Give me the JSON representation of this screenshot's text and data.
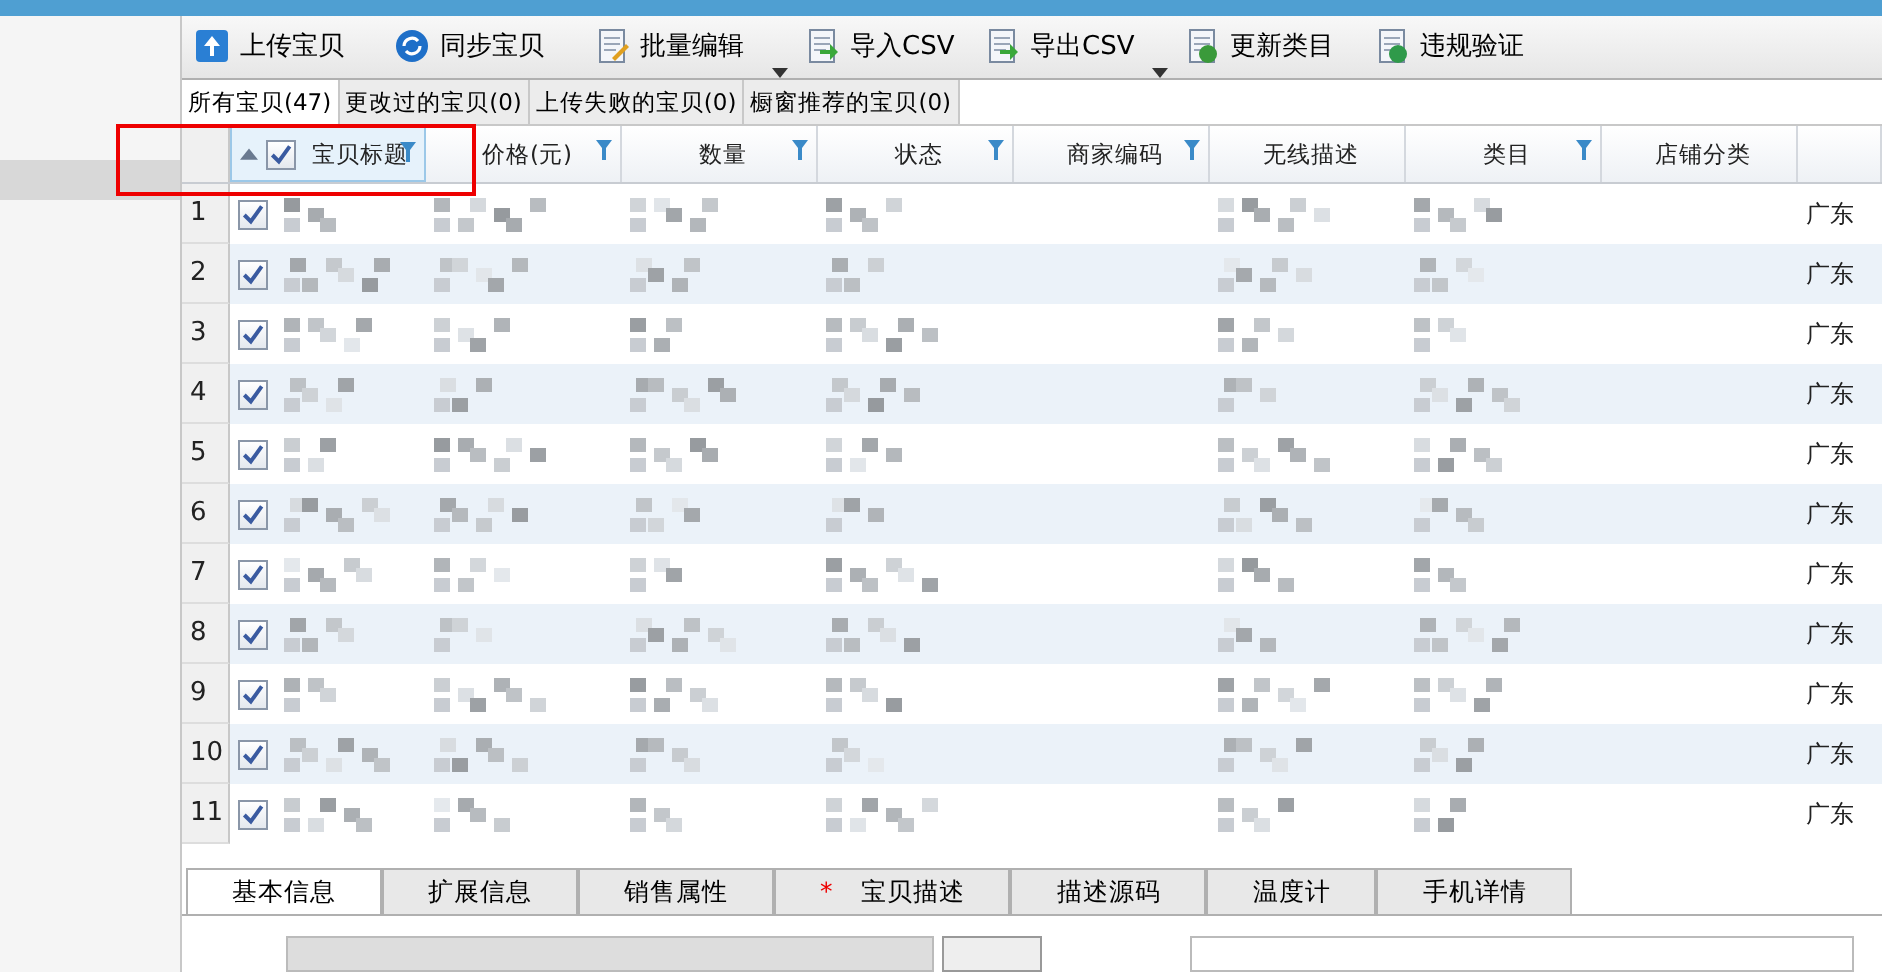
{
  "toolbar": [
    {
      "label": "上传宝贝",
      "kind": "upload",
      "menu": false
    },
    {
      "label": "同步宝贝",
      "kind": "sync",
      "menu": false
    },
    {
      "label": "批量编辑",
      "kind": "edit",
      "menu": true
    },
    {
      "label": "导入CSV",
      "kind": "import",
      "menu": false
    },
    {
      "label": "导出CSV",
      "kind": "export",
      "menu": true
    },
    {
      "label": "更新类目",
      "kind": "update",
      "menu": false
    },
    {
      "label": "违规验证",
      "kind": "verify",
      "menu": false
    }
  ],
  "filter_tabs": [
    {
      "label": "所有宝贝(47)",
      "selected": true
    },
    {
      "label": "更改过的宝贝(0)",
      "selected": false
    },
    {
      "label": "上传失败的宝贝(0)",
      "selected": false
    },
    {
      "label": "橱窗推荐的宝贝(0)",
      "selected": false
    }
  ],
  "table": {
    "all_checked": true,
    "columns": [
      {
        "label": "宝贝标题",
        "filter": true,
        "sorted": true
      },
      {
        "label": "价格(元)",
        "filter": true,
        "sorted": false
      },
      {
        "label": "数量",
        "filter": true,
        "sorted": false
      },
      {
        "label": "状态",
        "filter": true,
        "sorted": false
      },
      {
        "label": "商家编码",
        "filter": true,
        "sorted": false
      },
      {
        "label": "无线描述",
        "filter": false,
        "sorted": false
      },
      {
        "label": "类目",
        "filter": true,
        "sorted": false
      },
      {
        "label": "店铺分类",
        "filter": false,
        "sorted": false
      }
    ],
    "rows": [
      {
        "number": "1",
        "checked": true,
        "column_10": "广东"
      },
      {
        "number": "2",
        "checked": true,
        "column_10": "广东"
      },
      {
        "number": "3",
        "checked": true,
        "column_10": "广东"
      },
      {
        "number": "4",
        "checked": true,
        "column_10": "广东"
      },
      {
        "number": "5",
        "checked": true,
        "column_10": "广东"
      },
      {
        "number": "6",
        "checked": true,
        "column_10": "广东"
      },
      {
        "number": "7",
        "checked": true,
        "column_10": "广东"
      },
      {
        "number": "8",
        "checked": true,
        "column_10": "广东"
      },
      {
        "number": "9",
        "checked": true,
        "column_10": "广东"
      },
      {
        "number": "10",
        "checked": true,
        "column_10": "广东"
      },
      {
        "number": "11",
        "checked": true,
        "column_10": "广东"
      }
    ]
  },
  "detail_tabs": [
    {
      "label": "基本信息",
      "selected": true,
      "required": false
    },
    {
      "label": "扩展信息",
      "selected": false,
      "required": false
    },
    {
      "label": "销售属性",
      "selected": false,
      "required": false
    },
    {
      "label": "宝贝描述",
      "selected": false,
      "required": true,
      "required_mark": "*"
    },
    {
      "label": "描述源码",
      "selected": false,
      "required": false
    },
    {
      "label": "温度计",
      "selected": false,
      "required": false
    },
    {
      "label": "手机详情",
      "selected": false,
      "required": false
    }
  ]
}
